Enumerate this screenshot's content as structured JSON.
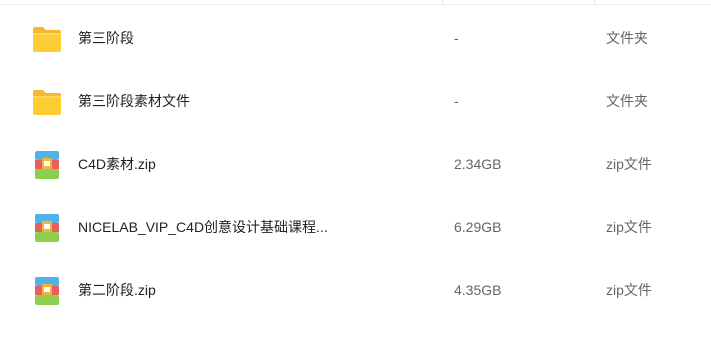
{
  "files": [
    {
      "name": "第三阶段",
      "size": "-",
      "type": "文件夹",
      "icon": "folder-icon",
      "icon_color": "#ffcc33"
    },
    {
      "name": "第三阶段素材文件",
      "size": "-",
      "type": "文件夹",
      "icon": "folder-icon",
      "icon_color": "#ffcc33"
    },
    {
      "name": "C4D素材.zip",
      "size": "2.34GB",
      "type": "zip文件",
      "icon": "zip-archive-icon"
    },
    {
      "name": "NICELAB_VIP_C4D创意设计基础课程...",
      "size": "6.29GB",
      "type": "zip文件",
      "icon": "zip-archive-icon"
    },
    {
      "name": "第二阶段.zip",
      "size": "4.35GB",
      "type": "zip文件",
      "icon": "zip-archive-icon"
    }
  ],
  "colors": {
    "name_text": "#222222",
    "meta_text": "#666666",
    "zip_top": "#4fb3e8",
    "zip_mid": "#e95f5f",
    "zip_bottom": "#8ccf4f",
    "zip_latch": "#f2b53a"
  }
}
